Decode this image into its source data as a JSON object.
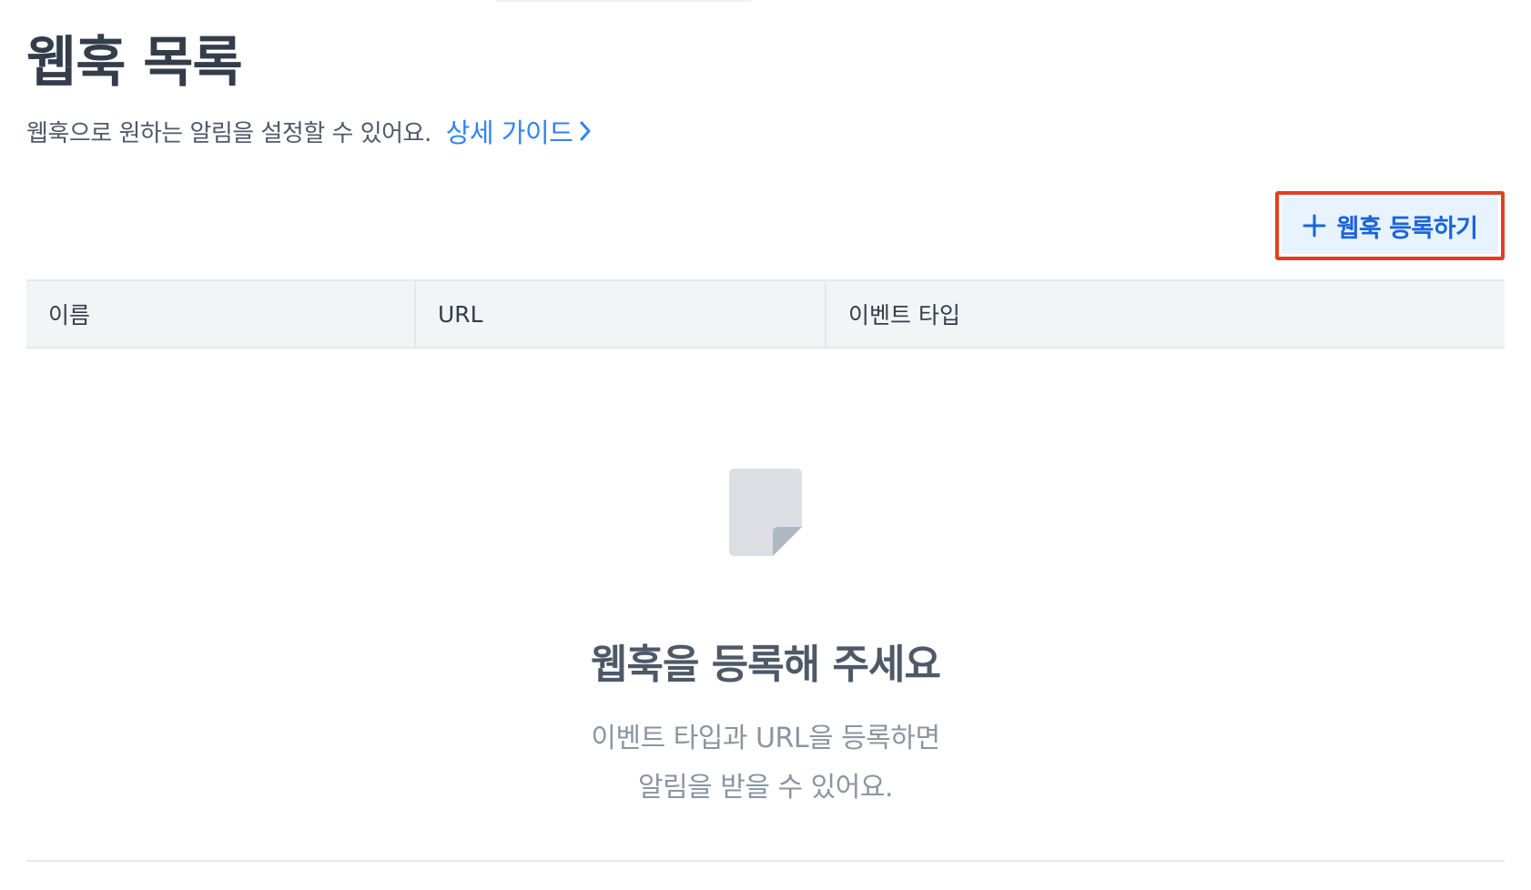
{
  "header": {
    "title": "웹훅 목록",
    "subtitle": "웹훅으로 원하는 알림을 설정할 수 있어요.",
    "guide_link": "상세 가이드"
  },
  "actions": {
    "add_webhook_label": "웹훅 등록하기",
    "add_icon": "plus-icon",
    "link_icon": "chevron-right-icon"
  },
  "table": {
    "columns": [
      "이름",
      "URL",
      "이벤트 타입"
    ]
  },
  "empty_state": {
    "icon": "document-icon",
    "title": "웹훅을 등록해 주세요",
    "description_line1": "이벤트 타입과 URL을 등록하면",
    "description_line2": "알림을 받을 수 있어요."
  },
  "colors": {
    "accent": "#3182f6",
    "button_background": "#e8f3ff",
    "button_text": "#1b64da",
    "highlight_border": "#e0401f",
    "table_header_background": "#f2f4f6"
  }
}
